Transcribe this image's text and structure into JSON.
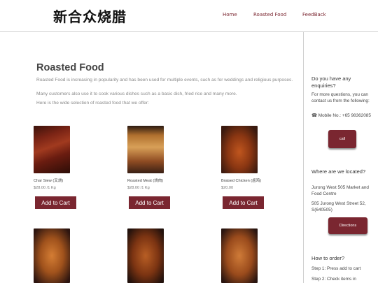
{
  "header": {
    "logo": "新合众烧腊",
    "nav": [
      {
        "label": "Home"
      },
      {
        "label": "Roasted Food"
      },
      {
        "label": "FeedBack"
      }
    ]
  },
  "main": {
    "title": "Roasted Food",
    "paragraphs": [
      "Roasted Food is increasing in popularity and has been used for multiple events, such as for weddings and religious purposes.",
      "Many customers also use it to cook various dishes such as a basic dish, fried rice and many more.",
      "Here is the wide selection of roasted food that we offer:"
    ],
    "products": [
      {
        "name": "Char Siew (叉烧)",
        "price": "$28.00 /1 Kg",
        "button": "Add to Cart",
        "image": "char-siew-image"
      },
      {
        "name": "Roasted Meat (烧肉)",
        "price": "$28.00 /1 Kg",
        "button": "Add to Cart",
        "image": "roasted-meat-image"
      },
      {
        "name": "Braised Chicken (卤鸡)",
        "price": "$20.00",
        "button": "Add to Cart",
        "image": "braised-chicken-image"
      },
      {
        "image": "roast-duck-image"
      },
      {
        "image": "roast-duck-image"
      },
      {
        "image": "roast-duck-image"
      }
    ]
  },
  "sidebar": {
    "enquiry_heading": "Do you have any enquiries?",
    "enquiry_text": "For more questions, you can contact us from the following:",
    "phone_icon": "☎",
    "phone_text": "Mobile No.: +65 98362085",
    "call_button": "call",
    "location_heading": "Where are we located?",
    "location_name": "Jurong West 505 Market and Food Centre",
    "location_address": "505 Jurong West Street 52, S(640505)",
    "directions_button": "Directions",
    "order_heading": "How to order?",
    "steps": [
      "Step 1: Press add to cart",
      "Step 2: Check items in"
    ]
  },
  "colors": {
    "accent": "#7a2630",
    "divider": "#cfcfcf"
  }
}
